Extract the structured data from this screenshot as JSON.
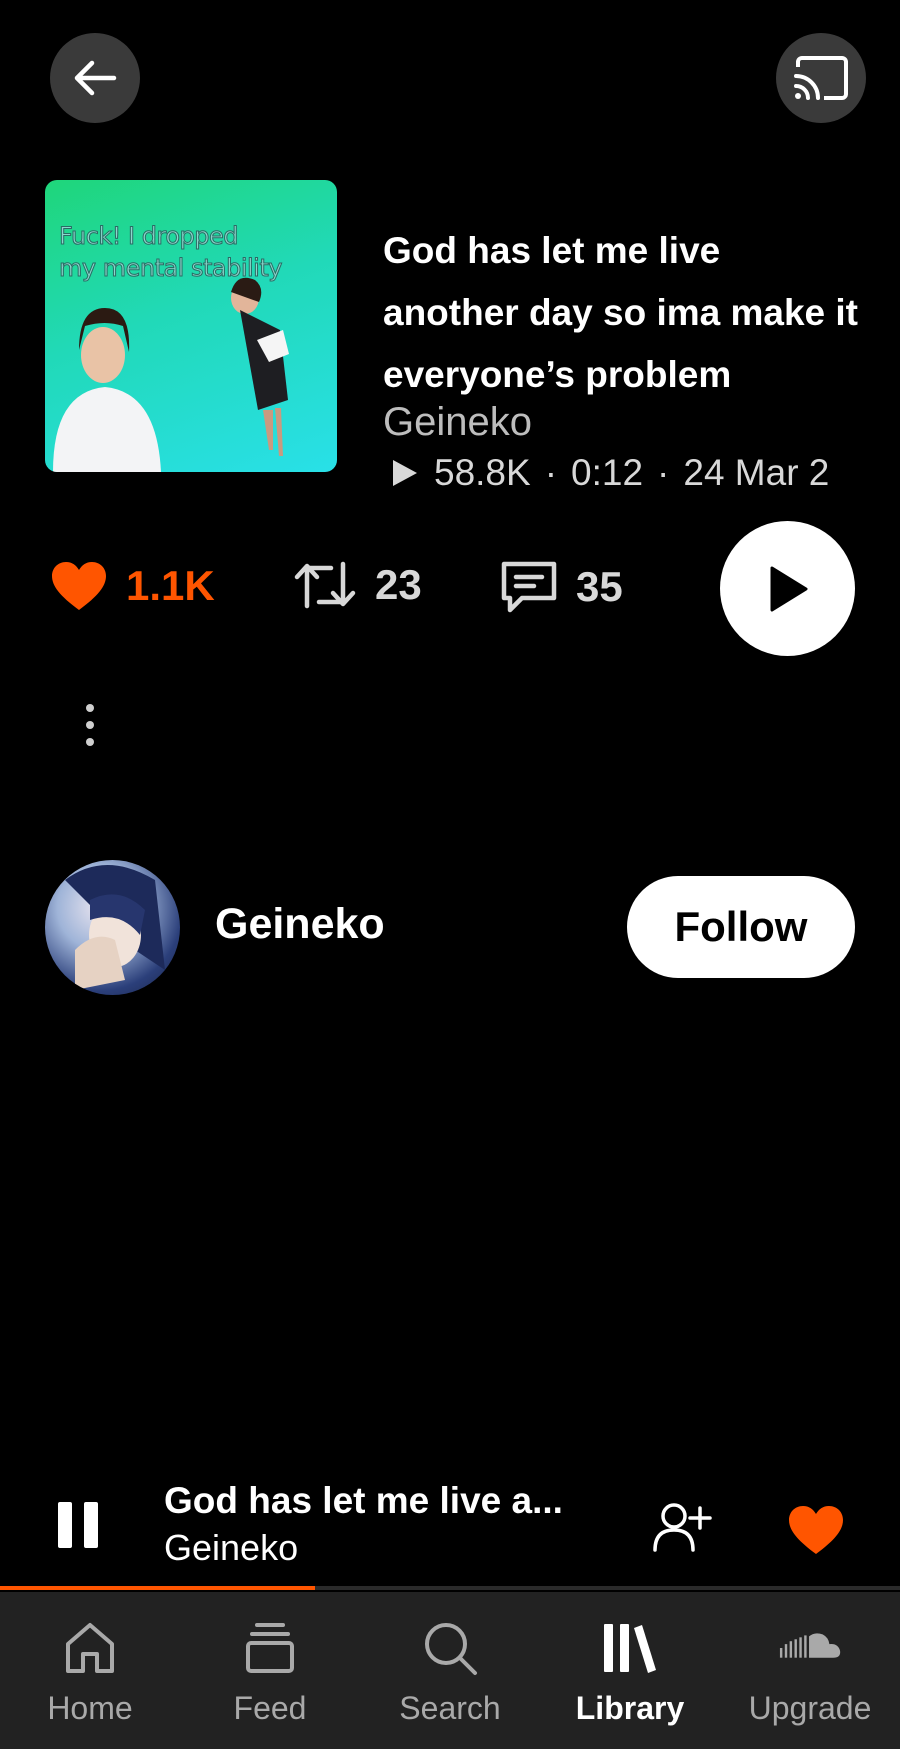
{
  "header": {
    "back_icon": "arrow-left-icon",
    "cast_icon": "cast-icon"
  },
  "track": {
    "artwork_caption_line1": "Fuck! I dropped",
    "artwork_caption_line2": "my mental stability",
    "title": "God has let me live another day so ima make it everyone’s problem",
    "artist": "Geineko",
    "plays": "58.8K",
    "duration": "0:12",
    "date": "24 Mar 2",
    "separator": "·"
  },
  "stats": {
    "likes": "1.1K",
    "reposts": "23",
    "comments": "35"
  },
  "uploader": {
    "name": "Geineko",
    "follow_label": "Follow"
  },
  "mini_player": {
    "title": "God has let me live a...",
    "artist": "Geineko",
    "progress": 0.35
  },
  "tabs": [
    {
      "label": "Home",
      "icon": "home-icon",
      "active": false
    },
    {
      "label": "Feed",
      "icon": "feed-icon",
      "active": false
    },
    {
      "label": "Search",
      "icon": "search-icon",
      "active": false
    },
    {
      "label": "Library",
      "icon": "library-icon",
      "active": true
    },
    {
      "label": "Upgrade",
      "icon": "soundcloud-icon",
      "active": false
    }
  ],
  "colors": {
    "accent": "#ff5500",
    "background": "#000000",
    "tabbar": "#222222"
  }
}
